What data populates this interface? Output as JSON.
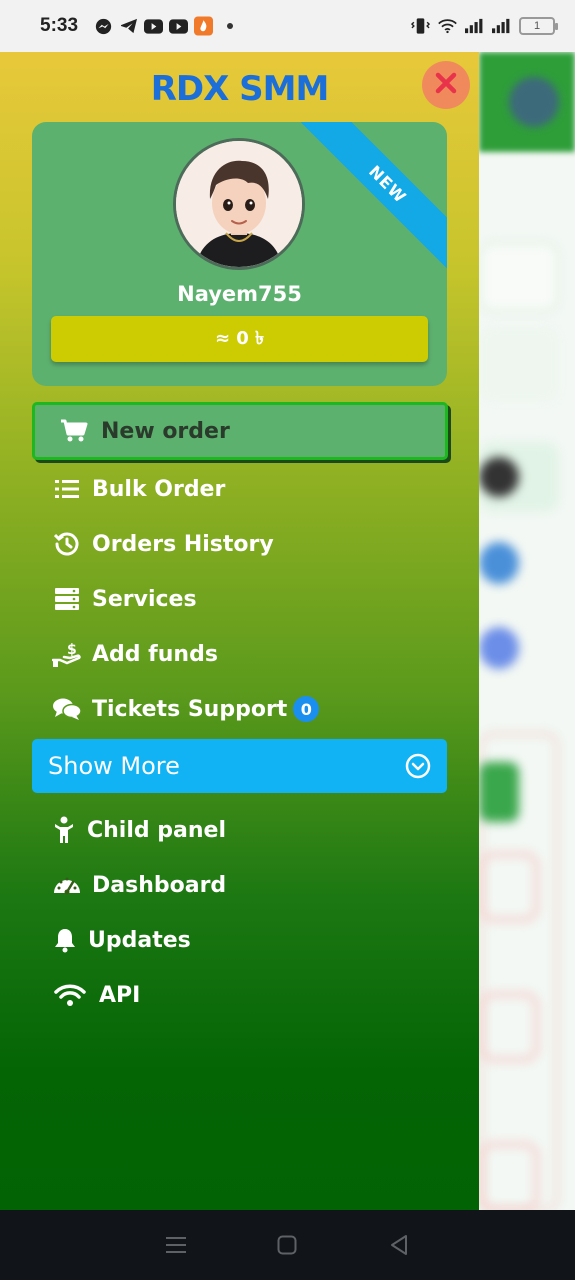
{
  "status_bar": {
    "time": "5:33",
    "battery": "1",
    "icons": [
      "messenger-icon",
      "telegram-icon",
      "youtube-icon",
      "youtube-icon",
      "app-icon",
      "vibrate-icon",
      "wifi-icon",
      "signal-icon",
      "signal-icon"
    ]
  },
  "drawer": {
    "brand": "RDX SMM",
    "close_icon": "close-icon",
    "profile": {
      "ribbon": "NEW",
      "username": "Nayem755",
      "balance": "≈ 0 ৳"
    },
    "menu": {
      "new_order": "New order",
      "bulk_order": "Bulk Order",
      "orders_history": "Orders History",
      "services": "Services",
      "add_funds": "Add funds",
      "tickets_support": "Tickets Support",
      "tickets_badge": "0",
      "show_more": "Show More",
      "child_panel": "Child panel",
      "dashboard": "Dashboard",
      "updates": "Updates",
      "api": "API"
    }
  },
  "colors": {
    "brand": "#1c6fd8",
    "card": "#5db16f",
    "balance": "#cdcc03",
    "show_more": "#11b3f4",
    "badge": "#1a8ff0"
  },
  "navbar": {
    "icons": [
      "menu-icon",
      "home-icon",
      "back-icon"
    ]
  }
}
